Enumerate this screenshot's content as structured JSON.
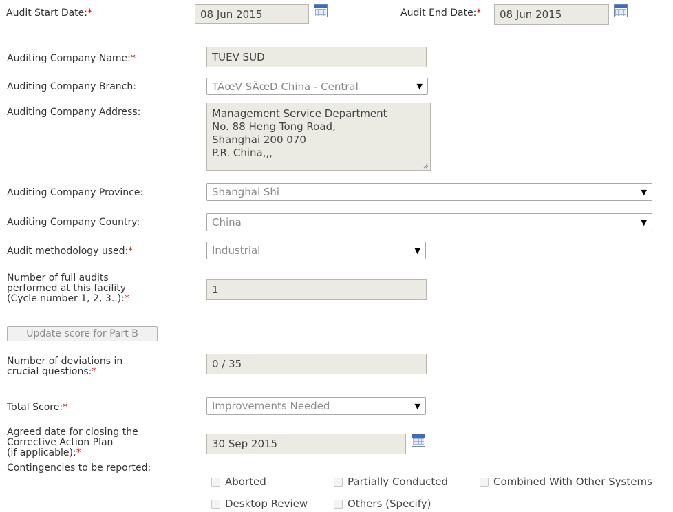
{
  "audit_start": {
    "label": "Audit Start Date:",
    "value": "08 Jun 2015"
  },
  "audit_end": {
    "label": "Audit End Date:",
    "value": "08 Jun 2015"
  },
  "company_name": {
    "label": "Auditing Company Name:",
    "value": "TUEV SUD"
  },
  "company_branch": {
    "label": "Auditing Company Branch:",
    "value": "TÃœV SÃœD China - Central"
  },
  "company_address": {
    "label": "Auditing Company Address:",
    "lines": [
      "Management Service Department",
      "No. 88 Heng Tong Road,",
      "Shanghai 200 070",
      "P.R. China,,,"
    ]
  },
  "company_province": {
    "label": "Auditing Company Province:",
    "value": "Shanghai Shi"
  },
  "company_country": {
    "label": "Auditing Company Country:",
    "value": "China"
  },
  "methodology": {
    "label": "Audit methodology used:",
    "value": "Industrial"
  },
  "full_audits": {
    "label_lines": [
      "Number of full audits",
      "performed at this facility",
      "(Cycle number 1, 2, 3..):"
    ],
    "value": "1"
  },
  "update_button": {
    "label": "Update score for Part B"
  },
  "deviations": {
    "label_lines": [
      "Number of deviations in",
      "crucial questions:"
    ],
    "value": "0 / 35"
  },
  "total_score": {
    "label": "Total Score:",
    "value": "Improvements Needed"
  },
  "agreed_date": {
    "label_lines": [
      "Agreed date for closing the",
      "Corrective Action Plan",
      "(if applicable):"
    ],
    "value": "30 Sep 2015"
  },
  "contingencies": {
    "label": "Contingencies to be reported:",
    "options": [
      "Aborted",
      "Partially Conducted",
      "Combined With Other Systems",
      "Desktop Review",
      "Others (Specify)"
    ]
  },
  "required_mark": "*",
  "dropdown_arrow": "▼",
  "colors": {
    "required": "#e00000",
    "readonly_bg": "#ebebe4",
    "calendar_blue": "#3f6bb8"
  }
}
